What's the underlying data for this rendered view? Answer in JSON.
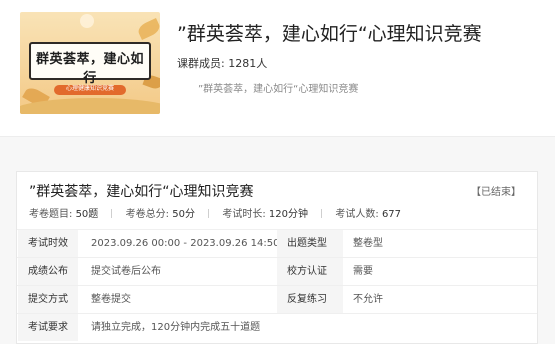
{
  "course": {
    "banner_title": "群英荟萃，建心如行",
    "banner_ribbon": "心理健康知识竞赛",
    "title": "”群英荟萃，建心如行“心理知识竞赛",
    "members_label": "课群成员:",
    "members_value": "1281人",
    "subline": "”群英荟萃，建心如行“心理知识竞赛"
  },
  "exam": {
    "title": "”群英荟萃，建心如行“心理知识竞赛",
    "status": "【已结束】",
    "meta": {
      "questions_label": "考卷题目:",
      "questions_value": "50题",
      "score_label": "考卷总分:",
      "score_value": "50分",
      "duration_label": "考试时长:",
      "duration_value": "120分钟",
      "participants_label": "考试人数:",
      "participants_value": "677"
    },
    "rows": [
      {
        "label1": "考试时效",
        "value1": "2023.09.26 00:00 - 2023.09.26 14:50",
        "label2": "出题类型",
        "value2": "整卷型"
      },
      {
        "label1": "成绩公布",
        "value1": "提交试卷后公布",
        "label2": "校方认证",
        "value2": "需要"
      },
      {
        "label1": "提交方式",
        "value1": "整卷提交",
        "label2": "反复练习",
        "value2": "不允许"
      },
      {
        "label1": "考试要求",
        "value1": "请独立完成，120分钟内完成五十道题"
      }
    ]
  }
}
